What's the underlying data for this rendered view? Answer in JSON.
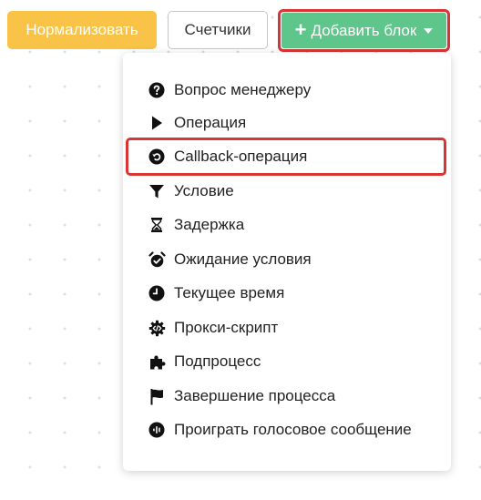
{
  "toolbar": {
    "normalize_label": "Нормализовать",
    "counters_label": "Счетчики",
    "add_block_label": "Добавить блок",
    "colors": {
      "normalize_bg": "#f8c346",
      "add_block_bg": "#5ec58b",
      "highlight": "#d93535"
    }
  },
  "menu": {
    "items": [
      {
        "label": "Вопрос менеджеру",
        "icon": "question-circle-icon"
      },
      {
        "label": "Операция",
        "icon": "play-icon"
      },
      {
        "label": "Callback-операция",
        "icon": "callback-icon"
      },
      {
        "label": "Условие",
        "icon": "filter-icon"
      },
      {
        "label": "Задержка",
        "icon": "hourglass-icon"
      },
      {
        "label": "Ожидание условия",
        "icon": "alarm-clock-icon"
      },
      {
        "label": "Текущее время",
        "icon": "clock-icon"
      },
      {
        "label": "Прокси-скрипт",
        "icon": "code-gear-icon"
      },
      {
        "label": "Подпроцесс",
        "icon": "puzzle-icon"
      },
      {
        "label": "Завершение процесса",
        "icon": "flag-icon"
      },
      {
        "label": "Проиграть голосовое сообщение",
        "icon": "voice-message-icon"
      }
    ]
  }
}
